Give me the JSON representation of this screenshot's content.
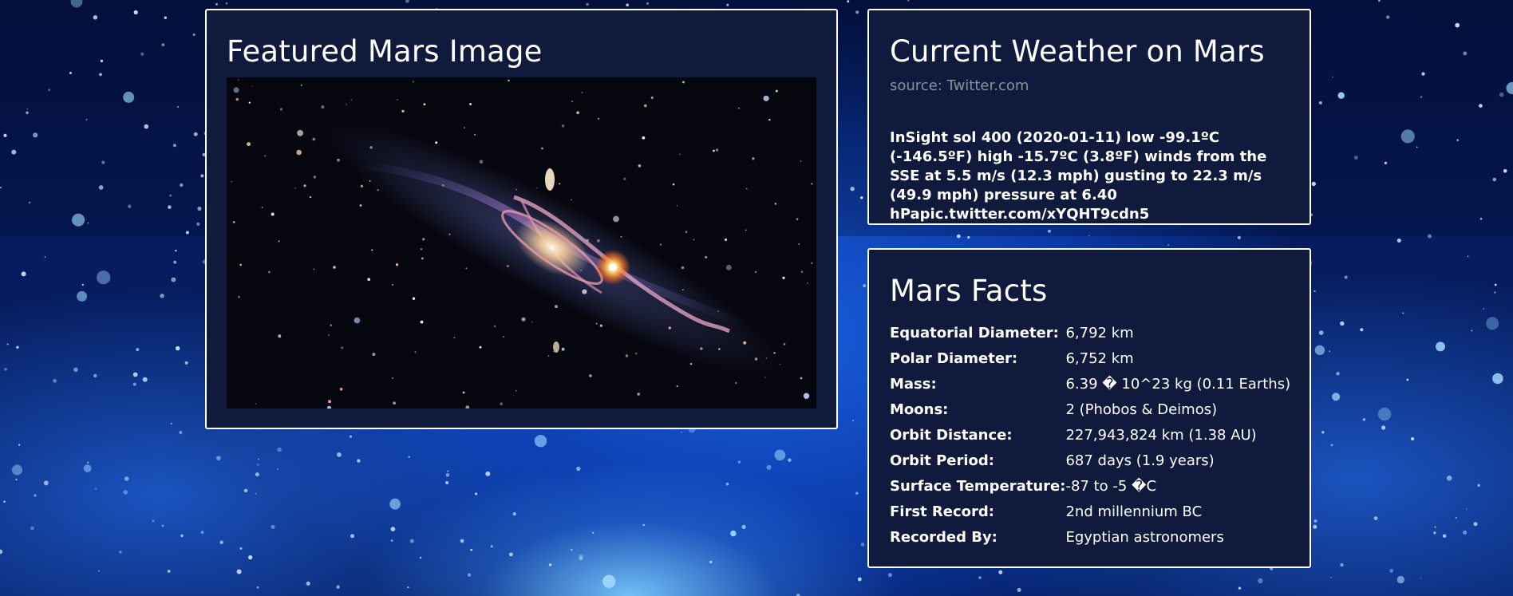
{
  "featured": {
    "title": "Featured Mars Image"
  },
  "weather": {
    "title": "Current Weather on Mars",
    "source": "source: Twitter.com",
    "tweet": "InSight sol 400 (2020-01-11) low -99.1ºC (-146.5ºF) high -15.7ºC (3.8ºF) winds from the SSE at 5.5 m/s (12.3 mph) gusting to 22.3 m/s (49.9 mph) pressure at 6.40 hPapic.twitter.com/xYQHT9cdn5"
  },
  "facts": {
    "title": "Mars Facts",
    "rows": [
      {
        "label": "Equatorial Diameter:",
        "value": "6,792 km"
      },
      {
        "label": "Polar Diameter:",
        "value": "6,752 km"
      },
      {
        "label": "Mass:",
        "value": "6.39 � 10^23 kg (0.11 Earths)"
      },
      {
        "label": "Moons:",
        "value": "2 (Phobos & Deimos)"
      },
      {
        "label": "Orbit Distance:",
        "value": "227,943,824 km (1.38 AU)"
      },
      {
        "label": "Orbit Period:",
        "value": "687 days (1.9 years)"
      },
      {
        "label": "Surface Temperature:",
        "value": "-87 to -5 �C"
      },
      {
        "label": "First Record:",
        "value": "2nd millennium BC"
      },
      {
        "label": "Recorded By:",
        "value": "Egyptian astronomers"
      }
    ]
  },
  "colors": {
    "panel_bg": "#0f1a3c",
    "panel_border": "#ffffff",
    "source_text": "#8b8f9b"
  }
}
